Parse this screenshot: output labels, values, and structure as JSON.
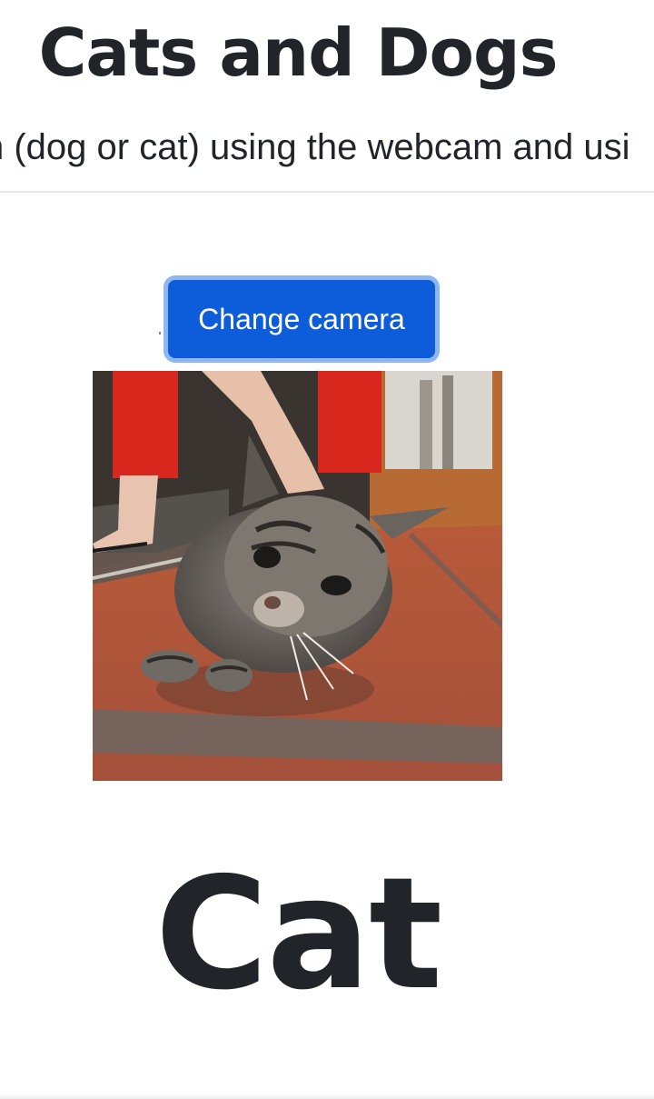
{
  "header": {
    "title": "Cats and Dogs",
    "subtitle": "n (dog or cat) using the webcam and usi"
  },
  "controls": {
    "change_camera_label": "Change camera"
  },
  "webcam": {
    "content": "live webcam frame showing a tabby cat on a red tiled floor"
  },
  "result": {
    "prediction": "Cat"
  },
  "colors": {
    "text": "#212529",
    "button_bg": "#0d5cd9",
    "button_focus_ring": "#8db6f5",
    "divider": "#e6e7e9"
  }
}
